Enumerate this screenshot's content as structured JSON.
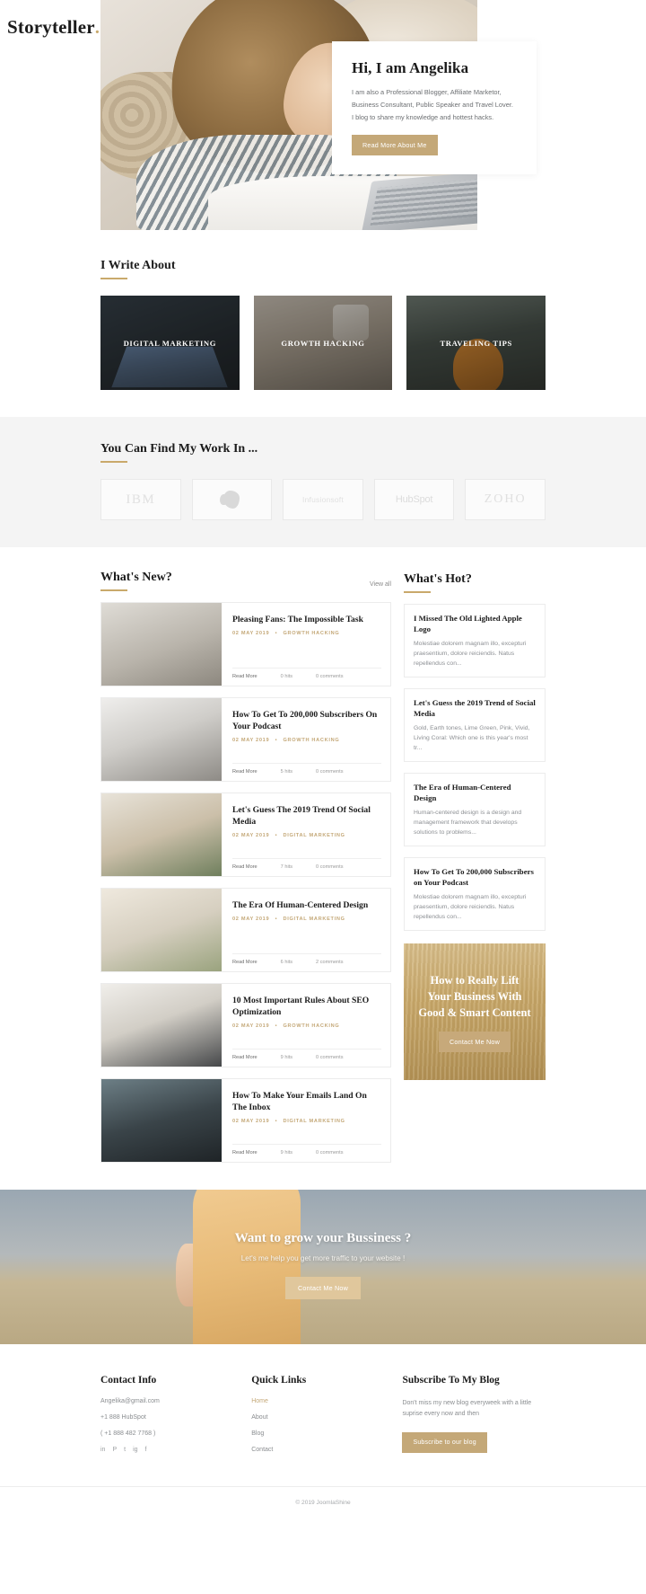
{
  "brand": {
    "name": "Storyteller",
    "dot": "."
  },
  "hero": {
    "title": "Hi, I am Angelika",
    "description": "I am also a Professional Blogger, Affiliate Marketor, Business Consultant, Public Speaker and Travel Lover. I blog to share my knowledge and hottest hacks.",
    "cta_label": "Read More About Me"
  },
  "write_about": {
    "heading": "I Write About",
    "categories": [
      {
        "label": "DIGITAL MARKETING"
      },
      {
        "label": "GROWTH HACKING"
      },
      {
        "label": "TRAVELING TIPS"
      }
    ]
  },
  "work_in": {
    "heading": "You Can Find My Work In ...",
    "logos": [
      {
        "name": "IBM",
        "icon": "ibm-logo"
      },
      {
        "name": "Evernote",
        "icon": "evernote-logo"
      },
      {
        "name": "Infusionsoft",
        "icon": "infusionsoft-logo"
      },
      {
        "name": "HubSpot",
        "icon": "hubspot-logo"
      },
      {
        "name": "ZOHO",
        "icon": "zoho-logo"
      }
    ]
  },
  "whats_new": {
    "heading": "What's New?",
    "view_all": "View all",
    "read_more": "Read More",
    "separator": "•",
    "posts": [
      {
        "title": "Pleasing Fans: The Impossible Task",
        "date": "02 MAY 2019",
        "category": "GROWTH HACKING",
        "hits": "0 hits",
        "comments": "0 comments"
      },
      {
        "title": "How To Get To 200,000 Subscribers On Your Podcast",
        "date": "02 MAY 2019",
        "category": "GROWTH HACKING",
        "hits": "5 hits",
        "comments": "0 comments"
      },
      {
        "title": "Let's Guess The 2019 Trend Of Social Media",
        "date": "02 MAY 2019",
        "category": "DIGITAL MARKETING",
        "hits": "7 hits",
        "comments": "0 comments"
      },
      {
        "title": "The Era Of Human-Centered Design",
        "date": "02 MAY 2019",
        "category": "DIGITAL MARKETING",
        "hits": "6 hits",
        "comments": "2 comments"
      },
      {
        "title": "10 Most Important Rules About SEO Optimization",
        "date": "02 MAY 2019",
        "category": "GROWTH HACKING",
        "hits": "9 hits",
        "comments": "0 comments"
      },
      {
        "title": "How To Make Your Emails Land On The Inbox",
        "date": "02 MAY 2019",
        "category": "DIGITAL MARKETING",
        "hits": "9 hits",
        "comments": "0 comments"
      }
    ]
  },
  "whats_hot": {
    "heading": "What's Hot?",
    "items": [
      {
        "title": "I Missed The Old Lighted Apple Logo",
        "excerpt": "Molestiae dolorem magnam illo, excepturi praesentium, dolore reiciendis. Natus repellendus con..."
      },
      {
        "title": "Let's Guess the 2019 Trend of Social Media",
        "excerpt": "Gold, Earth tones, Lime Green, Pink, Vivid, Living Coral: Which one is this year's most tr..."
      },
      {
        "title": "The Era of Human-Centered Design",
        "excerpt": "Human-centered design is a design and management framework that develops solutions to problems..."
      },
      {
        "title": "How To Get To 200,000 Subscribers on Your Podcast",
        "excerpt": "Molestiae dolorem magnam illo, excepturi praesentium, dolore reiciendis. Natus repellendus con..."
      }
    ],
    "promo": {
      "title": "How to Really Lift Your Business With Good & Smart Content",
      "cta_label": "Contact Me Now"
    }
  },
  "cta_banner": {
    "title": "Want to grow your Bussiness ?",
    "subtitle": "Let's me help you get more traffic to your website !",
    "button": "Contact Me Now"
  },
  "footer": {
    "contact": {
      "heading": "Contact Info",
      "email": "Angelika@gmail.com",
      "address": "+1 888 HubSpot",
      "phone": "( +1 888 482 7768 )",
      "socials": [
        "in",
        "P",
        "t",
        "ig",
        "f"
      ]
    },
    "quick_links": {
      "heading": "Quick Links",
      "links": [
        {
          "label": "Home",
          "active": true
        },
        {
          "label": "About",
          "active": false
        },
        {
          "label": "Blog",
          "active": false
        },
        {
          "label": "Contact",
          "active": false
        }
      ]
    },
    "subscribe": {
      "heading": "Subscribe To My Blog",
      "text": "Don't miss my new blog everyweek with a little suprise every now and then",
      "button": "Subscribe to our blog"
    },
    "copyright": "© 2019 JoomlaShine"
  },
  "colors": {
    "accent": "#c4a878",
    "gold": "#c9a96b",
    "dark": "#1b1b1b",
    "muted": "#8a8d90"
  }
}
